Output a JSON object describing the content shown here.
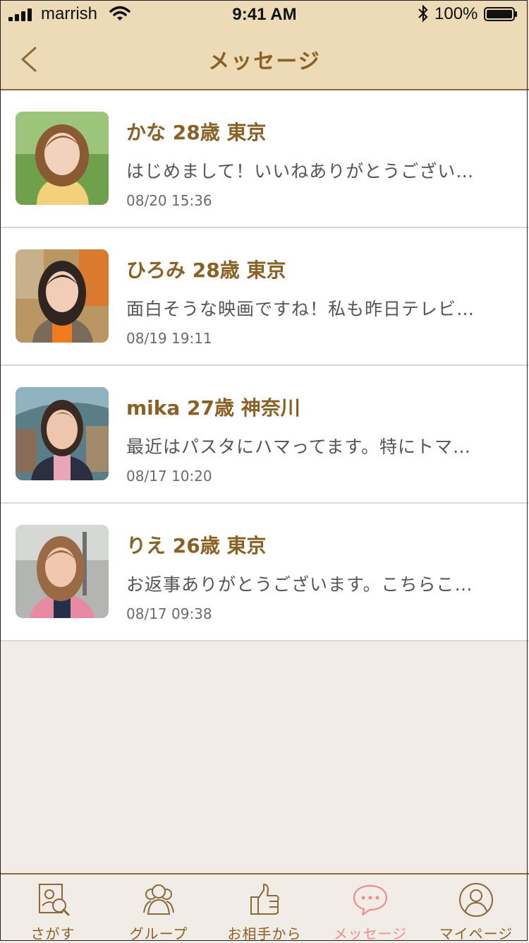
{
  "status_bar": {
    "carrier": "marrish",
    "time": "9:41 AM",
    "battery": "100%"
  },
  "header": {
    "title": "メッセージ"
  },
  "messages": [
    {
      "name": "かな 28歳 東京",
      "preview": "はじめまして！いいねありがとうござい…",
      "date": "08/20 15:36",
      "photo_bg": "#7fb05a",
      "top_color": "#f2d17a"
    },
    {
      "name": "ひろみ 28歳 東京",
      "preview": "面白そうな映画ですね！私も昨日テレビ…",
      "date": "08/19 19:11",
      "photo_bg": "#c9a06a",
      "top_color": "#f07a1c"
    },
    {
      "name": "mika 27歳 神奈川",
      "preview": "最近はパスタにハマってます。特にトマ…",
      "date": "08/17 10:20",
      "photo_bg": "#4f7a8a",
      "top_color": "#e8a6b8"
    },
    {
      "name": "りえ 26歳 東京",
      "preview": "お返事ありがとうございます。こちらこ…",
      "date": "08/17 09:38",
      "photo_bg": "#b7b9b5",
      "top_color": "#e88aa2"
    }
  ],
  "tabs": [
    {
      "label": "さがす",
      "icon": "search-profile-icon",
      "active": false
    },
    {
      "label": "グループ",
      "icon": "group-icon",
      "active": false
    },
    {
      "label": "お相手から",
      "icon": "thumbs-up-icon",
      "active": false
    },
    {
      "label": "メッセージ",
      "icon": "chat-bubble-icon",
      "active": true
    },
    {
      "label": "マイページ",
      "icon": "person-icon",
      "active": false
    }
  ],
  "colors": {
    "header_bg": "#ecdbb6",
    "accent": "#8a6125",
    "active_tab": "#f08c8c",
    "page_bg": "#f1ece6"
  }
}
